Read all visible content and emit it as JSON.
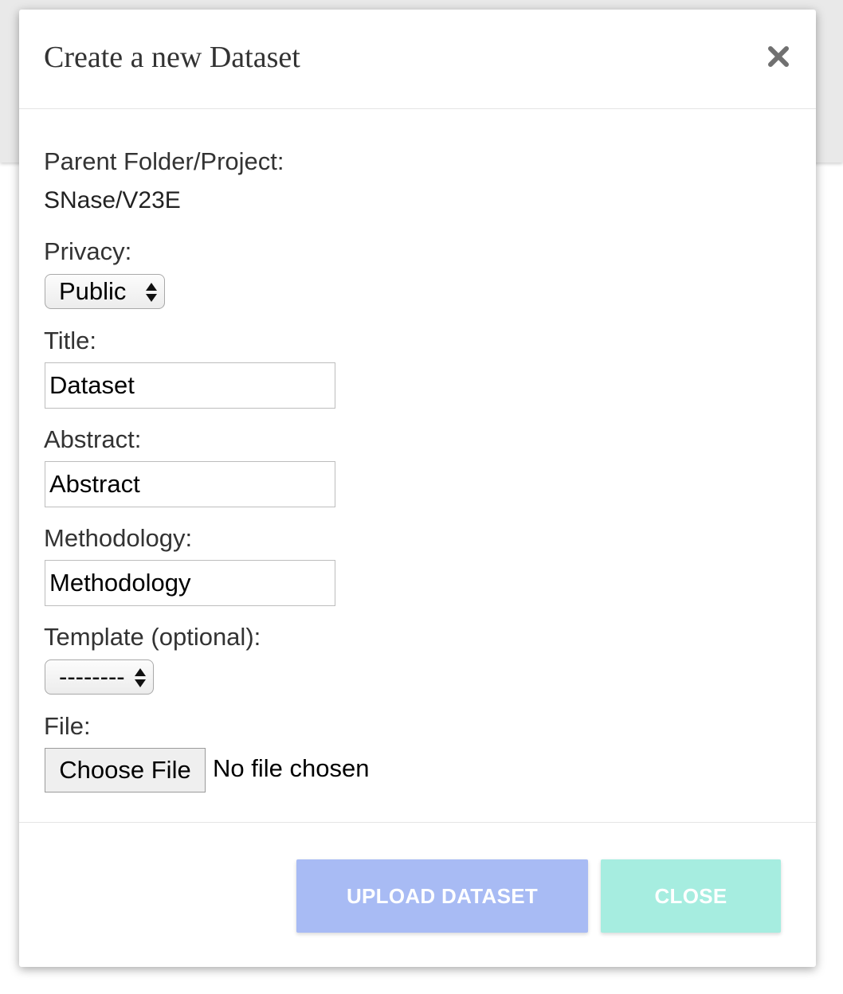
{
  "colors": {
    "upload_button_bg": "#a8bbf4",
    "close_button_bg": "#a6ede0"
  },
  "modal": {
    "title": "Create a new Dataset",
    "close_icon": "close-x-icon"
  },
  "form": {
    "parent_label": "Parent Folder/Project:",
    "parent_value": "SNase/V23E",
    "privacy_label": "Privacy:",
    "privacy_value": "Public",
    "title_label": "Title:",
    "title_value": "Dataset",
    "abstract_label": "Abstract:",
    "abstract_value": "Abstract",
    "methodology_label": "Methodology:",
    "methodology_value": "Methodology",
    "template_label": "Template (optional):",
    "template_value": "--------",
    "file_label": "File:",
    "file_button": "Choose File",
    "file_status": "No file chosen"
  },
  "footer": {
    "upload_label": "UPLOAD DATASET",
    "close_label": "CLOSE"
  }
}
